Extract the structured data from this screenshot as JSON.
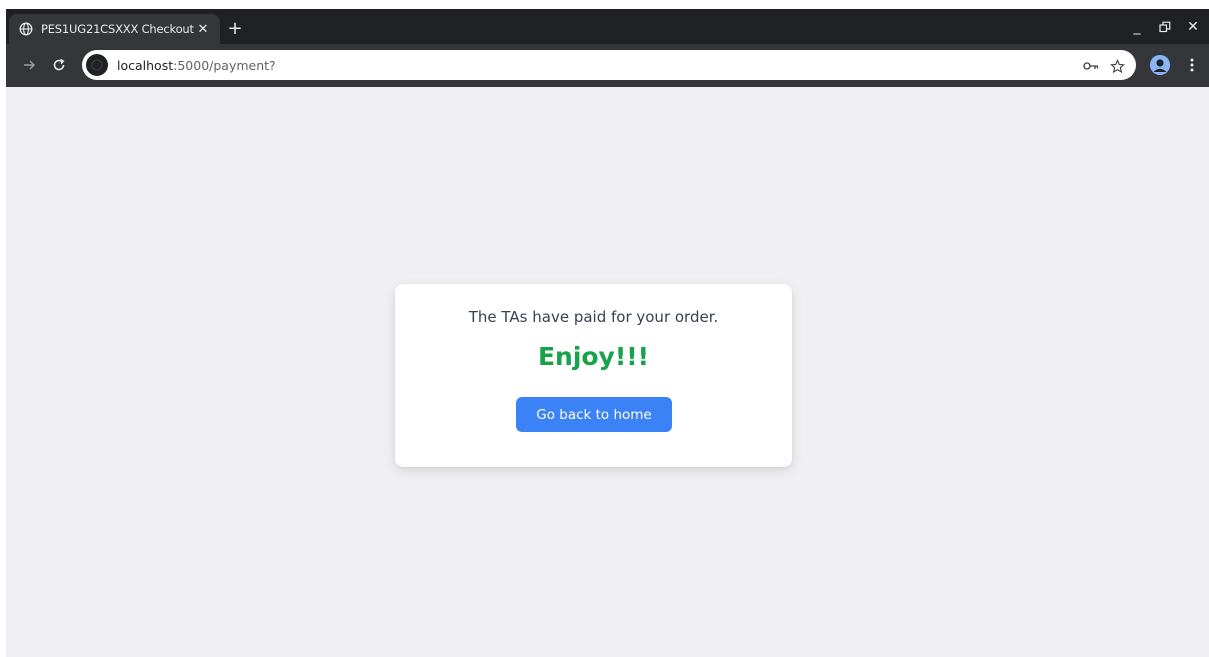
{
  "browser": {
    "tab": {
      "title": "PES1UG21CSXXX Checkout",
      "favicon": "globe-icon",
      "close_glyph": "✕"
    },
    "new_tab_glyph": "+",
    "window_controls": {
      "minimize": "_",
      "restore": "⧉",
      "close": "✕"
    },
    "url": {
      "host": "localhost",
      "path": ":5000/payment?"
    }
  },
  "page": {
    "message": "The TAs have paid for your order.",
    "title": "Enjoy!!!",
    "button_label": "Go back to home"
  },
  "colors": {
    "title_green": "#16a34a",
    "button_blue": "#3b82f6",
    "page_background": "#f0f0f4"
  }
}
